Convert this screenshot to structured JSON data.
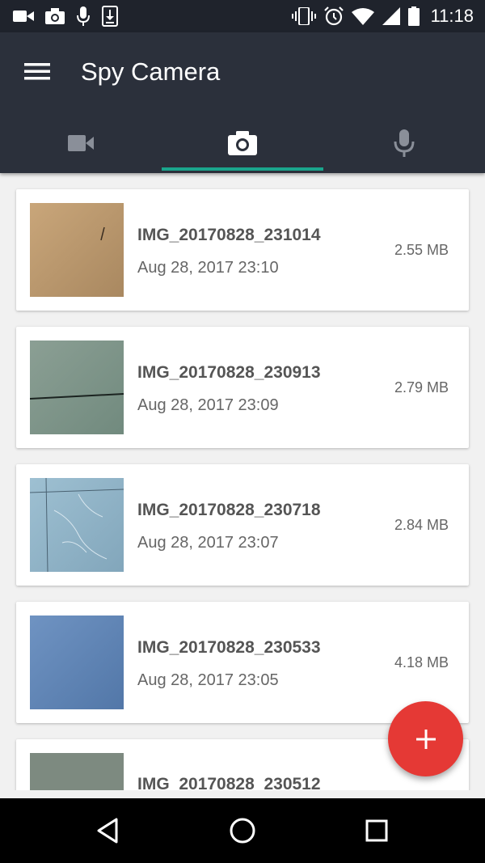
{
  "status_bar": {
    "time": "11:18",
    "left_icons": [
      "video-notification-icon",
      "camera-notification-icon",
      "mic-notification-icon",
      "download-notification-icon"
    ],
    "right_icons": [
      "vibrate-icon",
      "alarm-icon",
      "wifi-icon",
      "signal-icon",
      "battery-icon"
    ]
  },
  "app_bar": {
    "title": "Spy Camera",
    "menu_icon": "hamburger-menu-icon"
  },
  "tabs": [
    {
      "icon": "videocam-icon",
      "selected": false
    },
    {
      "icon": "camera-icon",
      "selected": true
    },
    {
      "icon": "mic-icon",
      "selected": false
    }
  ],
  "colors": {
    "app_bar": "#2b303b",
    "status_bar": "#1f232c",
    "tab_indicator": "#1aa58c",
    "fab": "#e53935",
    "background": "#f1f1f1"
  },
  "photos": [
    {
      "name": "IMG_20170828_231014",
      "date": "Aug 28, 2017 23:10",
      "size": "2.55 MB"
    },
    {
      "name": "IMG_20170828_230913",
      "date": "Aug 28, 2017 23:09",
      "size": "2.79 MB"
    },
    {
      "name": "IMG_20170828_230718",
      "date": "Aug 28, 2017 23:07",
      "size": "2.84 MB"
    },
    {
      "name": "IMG_20170828_230533",
      "date": "Aug 28, 2017 23:05",
      "size": "4.18 MB"
    },
    {
      "name": "IMG_20170828_230512",
      "date": "",
      "size": ""
    }
  ],
  "fab": {
    "icon": "add-icon"
  },
  "nav_bar": {
    "icons": [
      "back-icon",
      "home-icon",
      "recents-icon"
    ]
  }
}
